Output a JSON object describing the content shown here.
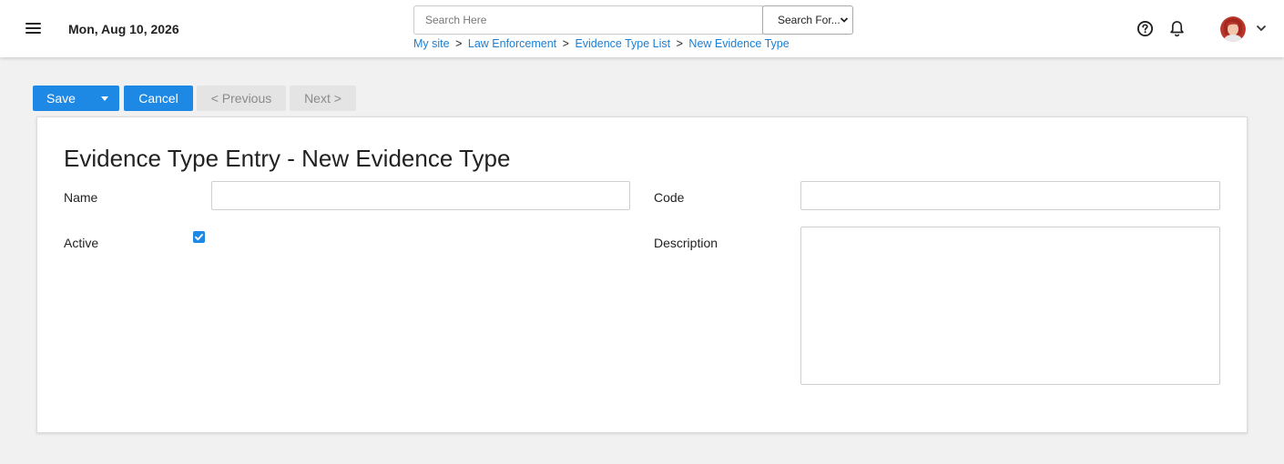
{
  "header": {
    "date": "Mon, Aug 10, 2026",
    "search_placeholder": "Search Here",
    "search_select_value": "Search For...",
    "breadcrumb": [
      {
        "label": "My site"
      },
      {
        "label": "Law Enforcement"
      },
      {
        "label": "Evidence Type List"
      },
      {
        "label": "New Evidence Type"
      }
    ],
    "breadcrumb_separator": ">",
    "icons": [
      "menu-icon",
      "help-icon",
      "bell-icon",
      "avatar",
      "chevron-down-icon"
    ]
  },
  "toolbar": {
    "save_label": "Save",
    "cancel_label": "Cancel",
    "previous_label": "< Previous",
    "next_label": "Next >"
  },
  "form": {
    "title": "Evidence Type Entry - New Evidence Type",
    "name_label": "Name",
    "name_value": "",
    "code_label": "Code",
    "code_value": "",
    "active_label": "Active",
    "active_checked": true,
    "description_label": "Description",
    "description_value": ""
  },
  "colors": {
    "primary": "#1e88e5",
    "link": "#1a7fd4",
    "background": "#f1f1f1",
    "disabled": "#e4e4e4"
  }
}
